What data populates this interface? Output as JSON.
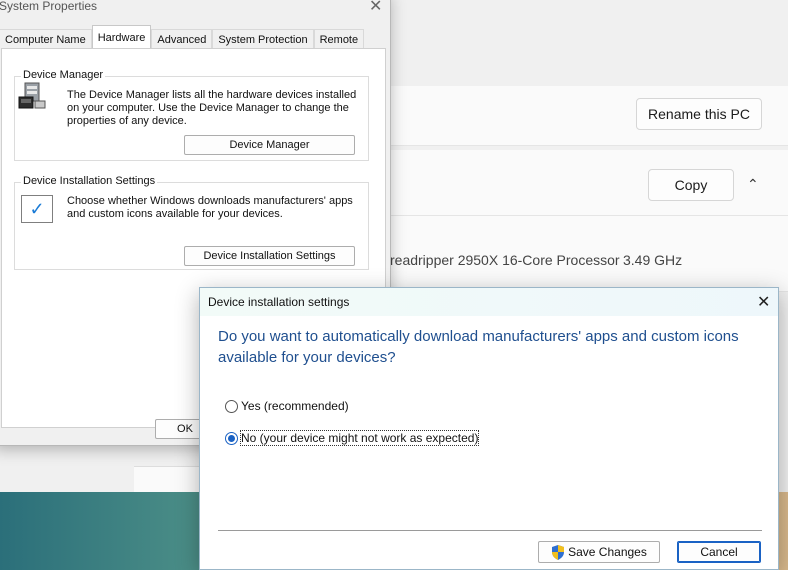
{
  "background": {
    "rename_button": "Rename this PC",
    "copy_button": "Copy",
    "processor_text": "readripper 2950X 16-Core Processor",
    "processor_speed": "3.49 GHz"
  },
  "system_properties": {
    "title": "System Properties",
    "tabs": [
      "Computer Name",
      "Hardware",
      "Advanced",
      "System Protection",
      "Remote"
    ],
    "active_tab": "Hardware",
    "device_manager": {
      "group_title": "Device Manager",
      "description_lines": [
        "The Device Manager lists all the hardware devices installed",
        "on your computer. Use the Device Manager to change the",
        "properties of any device."
      ],
      "button": "Device Manager"
    },
    "device_installation": {
      "group_title": "Device Installation Settings",
      "description_lines": [
        "Choose whether Windows downloads manufacturers' apps",
        "and custom icons available for your devices."
      ],
      "button": "Device Installation Settings"
    },
    "ok_button": "OK"
  },
  "device_install_dialog": {
    "title": "Device installation settings",
    "question": "Do you want to automatically download manufacturers' apps and custom icons available for your devices?",
    "options": [
      {
        "label": "Yes (recommended)",
        "selected": false
      },
      {
        "label": "No (your device might not work as expected)",
        "selected": true
      }
    ],
    "save_button": "Save Changes",
    "cancel_button": "Cancel"
  },
  "colors": {
    "question_text": "#1f4f8f",
    "radio_selected": "#1a62c4",
    "checkmark": "#1a7bd6"
  },
  "icons": [
    "close-icon",
    "device-manager-icon",
    "checkmark-icon",
    "chevron-up-icon",
    "shield-icon"
  ]
}
